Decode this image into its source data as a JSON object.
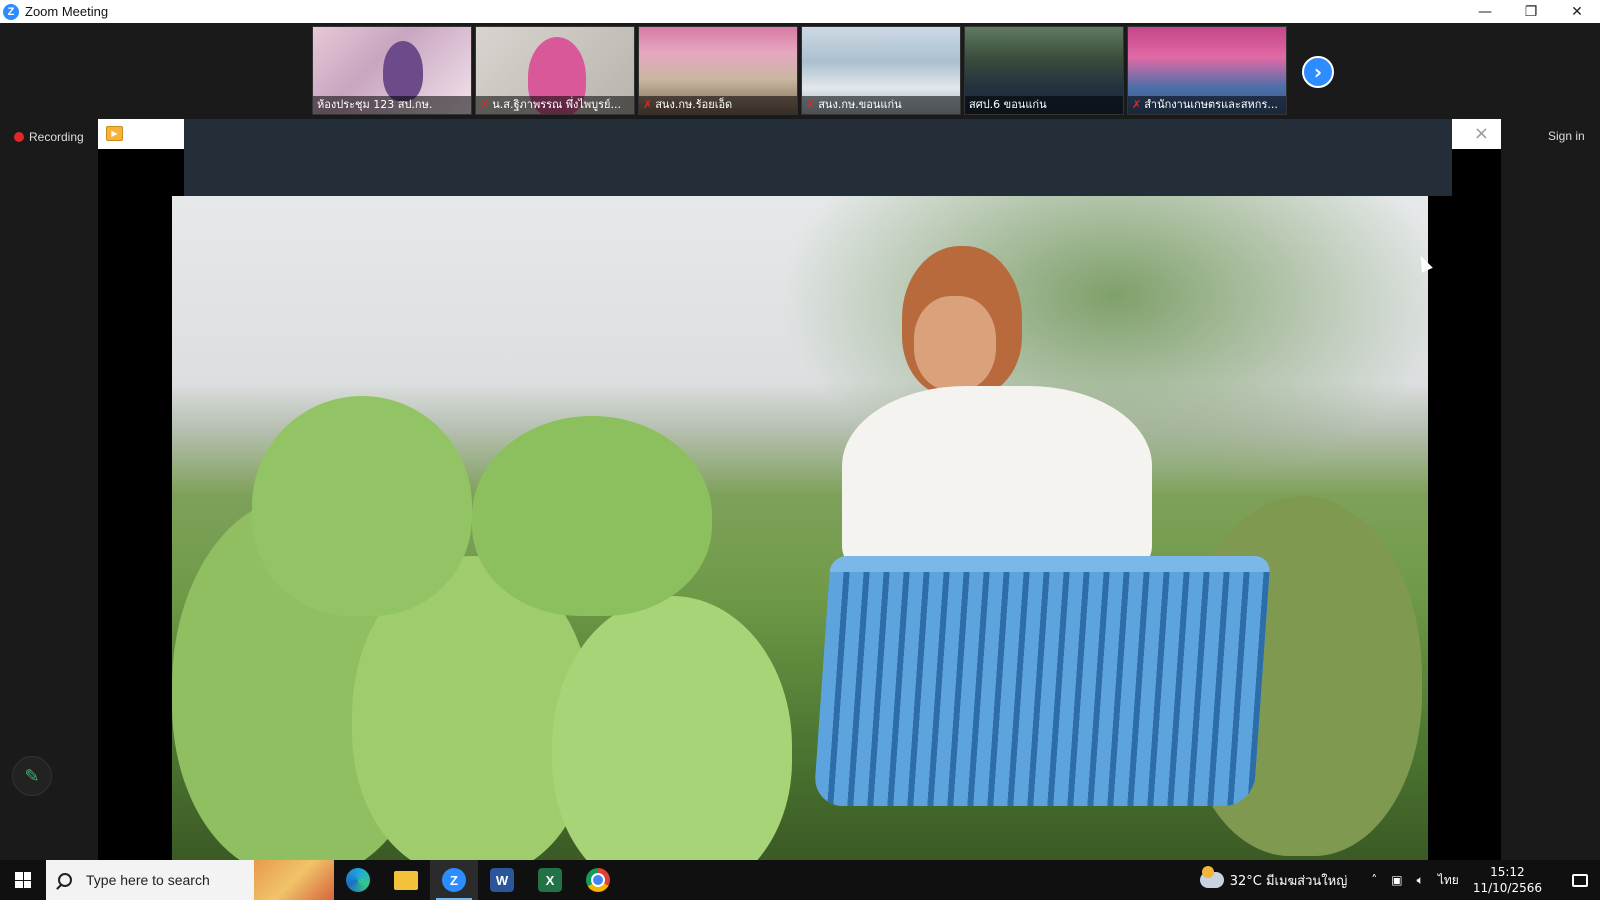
{
  "window": {
    "title": "Zoom Meeting",
    "logo_letter": "Z",
    "controls": [
      "minimize",
      "maximize",
      "close"
    ]
  },
  "participants": [
    {
      "name": "ห้องประชุม 123 สป.กษ.",
      "muted": false
    },
    {
      "name": "น.ส.ฐิภาพรรณ พึ่งไพบูรย์...",
      "muted": true
    },
    {
      "name": "สนง.กษ.ร้อยเอ็ด",
      "muted": true
    },
    {
      "name": "สนง.กษ.ขอนแก่น",
      "muted": true
    },
    {
      "name": "สศป.6 ขอนแก่น",
      "muted": false
    },
    {
      "name": "สำนักงานเกษตรและสหกร...",
      "muted": true
    }
  ],
  "recording": {
    "label": "Recording",
    "color": "#e02828"
  },
  "signin": {
    "label": "Sign in"
  },
  "share": {
    "close_glyph": "×"
  },
  "taskbar": {
    "search_placeholder": "Type here to search",
    "apps": [
      "edge",
      "file-explorer",
      "zoom",
      "word",
      "excel",
      "chrome"
    ],
    "active_app": "zoom",
    "weather": "32°C มีเมฆส่วนใหญ่",
    "lang": "ไทย",
    "time": "15:12",
    "date": "11/10/2566"
  },
  "colors": {
    "zoom_blue": "#2d8cff",
    "accent_green": "#3bb273"
  }
}
